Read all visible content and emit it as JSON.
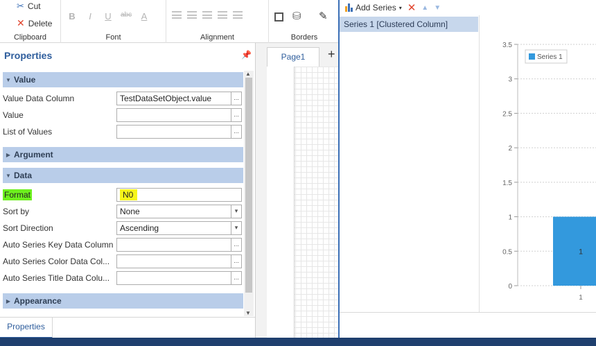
{
  "ribbon": {
    "clipboard": {
      "cut": "Cut",
      "delete": "Delete",
      "label": "Clipboard"
    },
    "font": {
      "label": "Font",
      "buttons": [
        "B",
        "I",
        "U",
        "abc",
        "A"
      ]
    },
    "alignment": {
      "label": "Alignment"
    },
    "borders": {
      "label": "Borders"
    }
  },
  "properties": {
    "title": "Properties",
    "sections": {
      "value": "Value",
      "argument": "Argument",
      "data": "Data",
      "appearance": "Appearance"
    },
    "value_rows": [
      {
        "label": "Value Data Column",
        "value": "TestDataSetObject.value"
      },
      {
        "label": "Value",
        "value": ""
      },
      {
        "label": "List of Values",
        "value": ""
      }
    ],
    "data_rows": [
      {
        "label": "Format",
        "value": "N0"
      },
      {
        "label": "Sort by",
        "value": "None"
      },
      {
        "label": "Sort Direction",
        "value": "Ascending"
      },
      {
        "label": "Auto Series Key Data Column",
        "value": ""
      },
      {
        "label": "Auto Series Color Data Col...",
        "value": ""
      },
      {
        "label": "Auto Series Title Data Colu...",
        "value": ""
      }
    ],
    "bottom_tab": "Properties"
  },
  "page": {
    "tab": "Page1",
    "add": "+"
  },
  "series_dialog": {
    "add_series": "Add Series",
    "series_items": [
      "Series 1 [Clustered Column]"
    ]
  },
  "chart_data": {
    "type": "bar",
    "categories": [
      "1"
    ],
    "series": [
      {
        "name": "Series 1",
        "values": [
          1
        ]
      }
    ],
    "ylim": [
      0,
      3.5
    ],
    "yticks": [
      "0",
      "0.5",
      "1",
      "1.5",
      "2",
      "2.5",
      "3",
      "3.5"
    ],
    "data_labels": [
      "1"
    ],
    "legend": "top-left",
    "grid": true,
    "colors": {
      "bar": "#3399dd"
    }
  }
}
